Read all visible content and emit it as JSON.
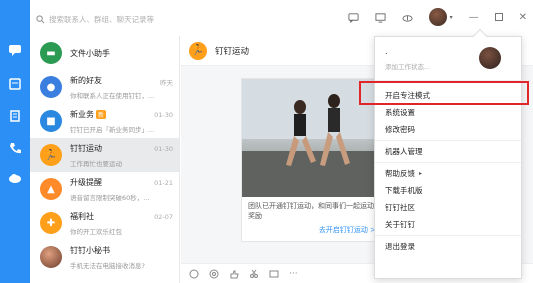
{
  "search": {
    "placeholder": "搜索联系人、群组、聊天记录等"
  },
  "conversations": [
    {
      "name": "文件小助手",
      "preview": "",
      "time": "",
      "avatar_color": "#2b9a52",
      "icon": "folder-icon"
    },
    {
      "name": "新的好友",
      "preview": "你和联系人正在使用钉钉，...",
      "time": "昨天",
      "avatar_color": "#3a7fe0",
      "icon": "user-add-icon"
    },
    {
      "name": "新业务",
      "badge": "新",
      "preview": "钉钉已开启「新业务同步」...",
      "time": "01-30",
      "avatar_color": "#2a88e0",
      "icon": "briefcase-icon"
    },
    {
      "name": "钉钉运动",
      "preview": "工作再忙也要运动",
      "time": "01-30",
      "avatar_color": "#ff9f1a",
      "icon": "runner-icon",
      "active": true
    },
    {
      "name": "升级提醒",
      "preview": "语音留言限制突破60秒，...",
      "time": "01-21",
      "avatar_color": "#ff8a2a",
      "icon": "upgrade-icon"
    },
    {
      "name": "福利社",
      "preview": "你的开工欢乐红包",
      "time": "02-07",
      "avatar_color": "#ff9f1a",
      "icon": "gift-icon"
    },
    {
      "name": "钉钉小秘书",
      "preview": "手机无法在电脑接收消息?",
      "time": "",
      "avatar_color": "#d0866a",
      "icon": "secretary-avatar"
    }
  ],
  "chat": {
    "title": "钉钉运动",
    "card_desc": "团队已开通钉钉运动，和同事们一起运动奖励",
    "card_link": "去开启钉钉运动 >"
  },
  "menu": {
    "username": ".",
    "status_placeholder": "添加工作状态...",
    "items": [
      {
        "label": "开启专注模式"
      },
      {
        "label": "系统设置"
      },
      {
        "label": "修改密码"
      },
      {
        "label": "机器人管理"
      },
      {
        "label": "帮助反馈",
        "arrow": "▸"
      },
      {
        "label": "下载手机版"
      },
      {
        "label": "钉钉社区"
      },
      {
        "label": "关于钉钉"
      },
      {
        "label": "退出登录"
      }
    ]
  },
  "colors": {
    "accent": "#2b8ff5",
    "highlight": "#e0262b"
  }
}
